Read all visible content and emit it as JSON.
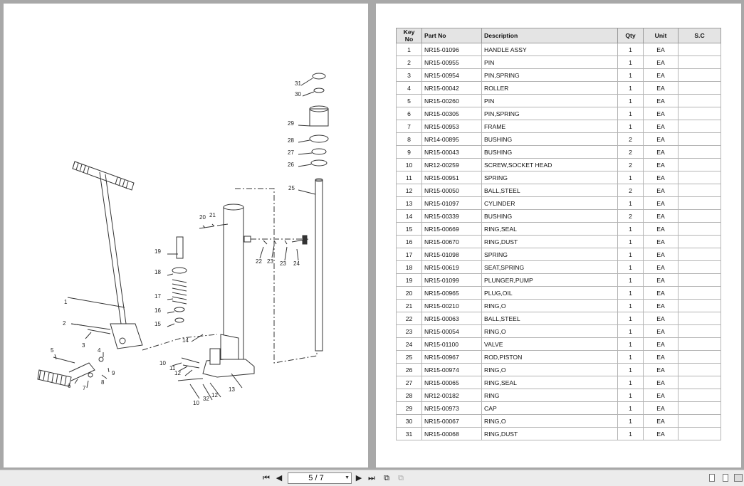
{
  "viewer": {
    "page_indicator": "5 / 7",
    "toolbar": {
      "first": "first-page-icon",
      "prev": "previous-page-icon",
      "next": "next-page-icon",
      "last": "last-page-icon",
      "facing": "facing-pages-icon",
      "single": "single-page-icon"
    }
  },
  "diagram": {
    "callouts": [
      "1",
      "2",
      "3",
      "4",
      "5",
      "6",
      "7",
      "8",
      "9",
      "10",
      "11",
      "12",
      "13",
      "14",
      "15",
      "16",
      "17",
      "18",
      "19",
      "20",
      "21",
      "22",
      "23",
      "23",
      "24",
      "25",
      "26",
      "27",
      "28",
      "29",
      "30",
      "31",
      "32",
      "10",
      "12"
    ]
  },
  "table": {
    "headers": [
      "Key No",
      "Part No",
      "Description",
      "Qty",
      "Unit",
      "S.C"
    ],
    "rows": [
      [
        "1",
        "NR15-01096",
        "HANDLE ASSY",
        "1",
        "EA",
        ""
      ],
      [
        "2",
        "NR15-00955",
        "PIN",
        "1",
        "EA",
        ""
      ],
      [
        "3",
        "NR15-00954",
        "PIN,SPRING",
        "1",
        "EA",
        ""
      ],
      [
        "4",
        "NR15-00042",
        "ROLLER",
        "1",
        "EA",
        ""
      ],
      [
        "5",
        "NR15-00260",
        "PIN",
        "1",
        "EA",
        ""
      ],
      [
        "6",
        "NR15-00305",
        "PIN,SPRING",
        "1",
        "EA",
        ""
      ],
      [
        "7",
        "NR15-00953",
        "FRAME",
        "1",
        "EA",
        ""
      ],
      [
        "8",
        "NR14-00895",
        "BUSHING",
        "2",
        "EA",
        ""
      ],
      [
        "9",
        "NR15-00043",
        "BUSHING",
        "2",
        "EA",
        ""
      ],
      [
        "10",
        "NR12-00259",
        "SCREW,SOCKET HEAD",
        "2",
        "EA",
        ""
      ],
      [
        "11",
        "NR15-00951",
        "SPRING",
        "1",
        "EA",
        ""
      ],
      [
        "12",
        "NR15-00050",
        "BALL,STEEL",
        "2",
        "EA",
        ""
      ],
      [
        "13",
        "NR15-01097",
        "CYLINDER",
        "1",
        "EA",
        ""
      ],
      [
        "14",
        "NR15-00339",
        "BUSHING",
        "2",
        "EA",
        ""
      ],
      [
        "15",
        "NR15-00669",
        "RING,SEAL",
        "1",
        "EA",
        ""
      ],
      [
        "16",
        "NR15-00670",
        "RING,DUST",
        "1",
        "EA",
        ""
      ],
      [
        "17",
        "NR15-01098",
        "SPRING",
        "1",
        "EA",
        ""
      ],
      [
        "18",
        "NR15-00619",
        "SEAT,SPRING",
        "1",
        "EA",
        ""
      ],
      [
        "19",
        "NR15-01099",
        "PLUNGER,PUMP",
        "1",
        "EA",
        ""
      ],
      [
        "20",
        "NR15-00965",
        "PLUG,OIL",
        "1",
        "EA",
        ""
      ],
      [
        "21",
        "NR15-00210",
        "RING,O",
        "1",
        "EA",
        ""
      ],
      [
        "22",
        "NR15-00063",
        "BALL,STEEL",
        "1",
        "EA",
        ""
      ],
      [
        "23",
        "NR15-00054",
        "RING,O",
        "1",
        "EA",
        ""
      ],
      [
        "24",
        "NR15-01100",
        "VALVE",
        "1",
        "EA",
        ""
      ],
      [
        "25",
        "NR15-00967",
        "ROD,PISTON",
        "1",
        "EA",
        ""
      ],
      [
        "26",
        "NR15-00974",
        "RING,O",
        "1",
        "EA",
        ""
      ],
      [
        "27",
        "NR15-00065",
        "RING,SEAL",
        "1",
        "EA",
        ""
      ],
      [
        "28",
        "NR12-00182",
        "RING",
        "1",
        "EA",
        ""
      ],
      [
        "29",
        "NR15-00973",
        "CAP",
        "1",
        "EA",
        ""
      ],
      [
        "30",
        "NR15-00067",
        "RING,O",
        "1",
        "EA",
        ""
      ],
      [
        "31",
        "NR15-00068",
        "RING,DUST",
        "1",
        "EA",
        ""
      ]
    ]
  }
}
